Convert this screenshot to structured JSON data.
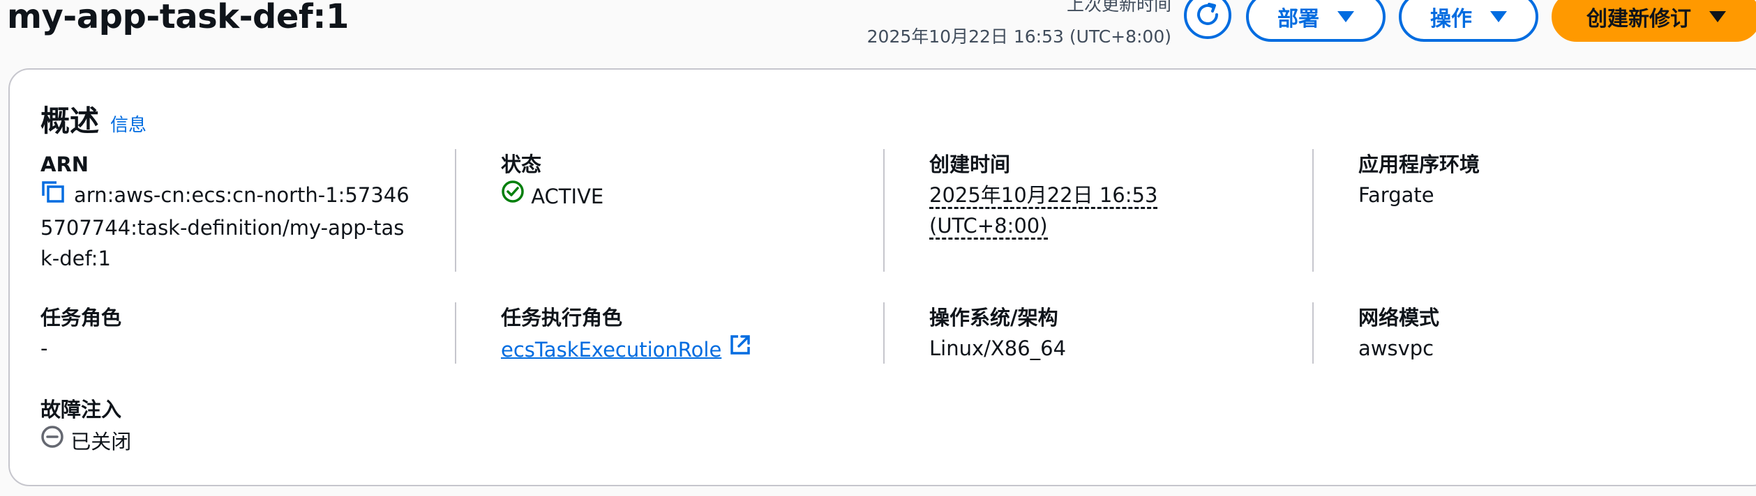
{
  "header": {
    "title": "my-app-task-def:1",
    "last_updated_label": "上次更新时间",
    "last_updated_value": "2025年10月22日 16:53 (UTC+8:00)",
    "deploy_label": "部署",
    "actions_label": "操作",
    "create_revision_label": "创建新修订"
  },
  "overview": {
    "title": "概述",
    "info_link": "信息",
    "fields": {
      "arn": {
        "label": "ARN",
        "lines": [
          "arn:aws-cn:ecs:cn-north-1:57346",
          "5707744:task-definition/my-app-tas",
          "k-def:1"
        ]
      },
      "status": {
        "label": "状态",
        "value": "ACTIVE"
      },
      "created": {
        "label": "创建时间",
        "line1": "2025年10月22日 16:53",
        "line2": "(UTC+8:00)"
      },
      "app_env": {
        "label": "应用程序环境",
        "value": "Fargate"
      },
      "task_role": {
        "label": "任务角色",
        "value": "-"
      },
      "exec_role": {
        "label": "任务执行角色",
        "value": "ecsTaskExecutionRole"
      },
      "os_arch": {
        "label": "操作系统/架构",
        "value": "Linux/X86_64"
      },
      "network_mode": {
        "label": "网络模式",
        "value": "awsvpc"
      },
      "fault_injection": {
        "label": "故障注入",
        "value": "已关闭"
      }
    }
  },
  "colors": {
    "link": "#006ce0",
    "primary_button": "#ff9900",
    "status_active": "#037f0c",
    "status_disabled": "#656871",
    "border": "#c6c6cd"
  },
  "icons": [
    "refresh-icon",
    "caret-down-icon",
    "copy-icon",
    "status-success-icon",
    "external-link-icon",
    "status-stopped-icon"
  ]
}
